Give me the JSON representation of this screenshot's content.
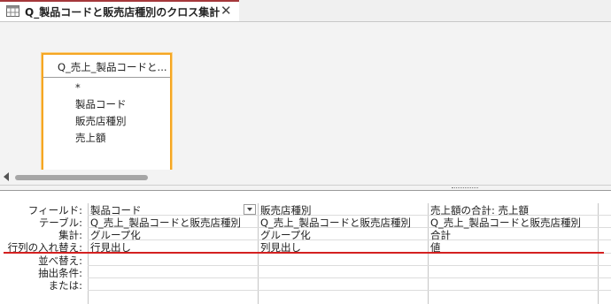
{
  "tab": {
    "title": "Q_製品コードと販売店種別のクロス集計",
    "close": "✕"
  },
  "table": {
    "title": "Q_売上_製品コードと...",
    "fields": [
      "*",
      "製品コード",
      "販売店種別",
      "売上額"
    ]
  },
  "grid": {
    "row_labels": [
      "フィールド:",
      "テーブル:",
      "集計:",
      "行列の入れ替え:",
      "並べ替え:",
      "抽出条件:",
      "または:"
    ],
    "columns": [
      {
        "field": "製品コード",
        "table": "Q_売上_製品コードと販売店種別",
        "total": "グループ化",
        "crosstab": "行見出し"
      },
      {
        "field": "販売店種別",
        "table": "Q_売上_製品コードと販売店種別",
        "total": "グループ化",
        "crosstab": "列見出し"
      },
      {
        "field": "売上額の合計: 売上額",
        "table": "Q_売上_製品コードと販売店種別",
        "total": "合計",
        "crosstab": "値"
      }
    ]
  },
  "colors": {
    "tab_accent": "#a4373a",
    "table_highlight": "#f5a623",
    "annotation_line": "#d42020"
  }
}
